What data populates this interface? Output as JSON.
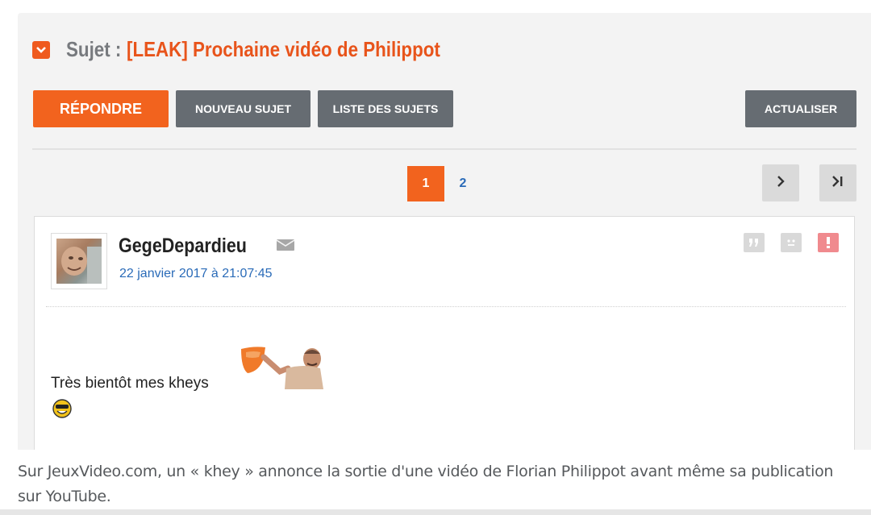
{
  "topic": {
    "prefix": "Sujet :",
    "title": "[LEAK] Prochaine vidéo de Philippot"
  },
  "toolbar": {
    "reply_label": "RÉPONDRE",
    "new_topic_label": "NOUVEAU SUJET",
    "topic_list_label": "LISTE DES SUJETS",
    "refresh_label": "ACTUALISER"
  },
  "pagination": {
    "current": "1",
    "other": "2"
  },
  "post": {
    "author": "GegeDepardieu",
    "date": "22 janvier 2017 à 21:07:45",
    "body": "Très bientôt mes kheys"
  },
  "caption": "Sur JeuxVideo.com, un « khey » annonce la sortie d'une vidéo de Florian Philippot avant même sa publication sur YouTube.",
  "colors": {
    "accent": "#f2631e",
    "button_gray": "#666c72",
    "link_blue": "#2a6bb8",
    "report_red": "#f08a8e"
  }
}
